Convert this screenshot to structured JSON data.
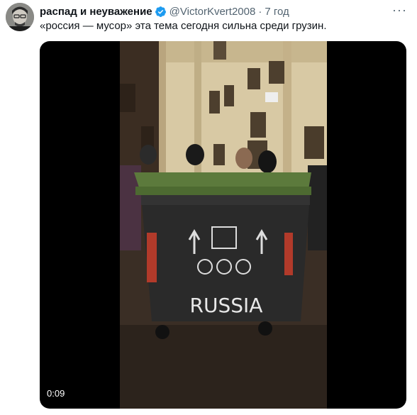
{
  "tweet": {
    "display_name": "распад и неуважение",
    "handle": "@VictorKvert2008",
    "separator": "·",
    "time": "7 год",
    "more_label": "···",
    "text": "«россия — мусор» эта тема сегодня сильна среди грузин."
  },
  "media": {
    "duration": "0:09",
    "container_graffiti": "RUSSIA"
  },
  "colors": {
    "verified": "#1d9bf0",
    "secondary_text": "#536471",
    "media_background": "#000000"
  }
}
